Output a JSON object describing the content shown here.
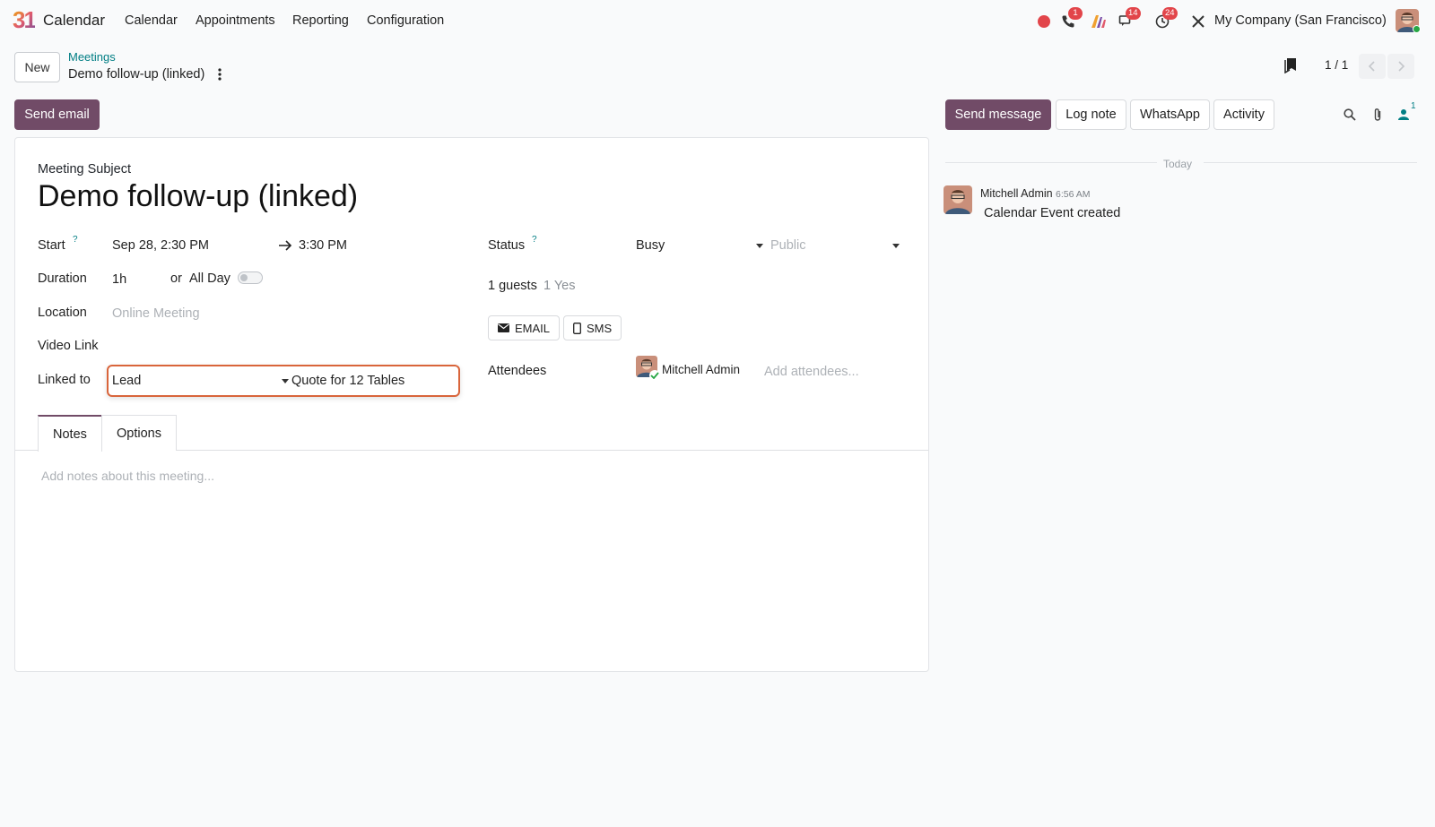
{
  "nav": {
    "app_name": "Calendar",
    "logo_text": "31",
    "menu": [
      "Calendar",
      "Appointments",
      "Reporting",
      "Configuration"
    ],
    "badges": {
      "calls": "1",
      "messages": "14",
      "activities": "24"
    },
    "company": "My Company (San Francisco)"
  },
  "control": {
    "new_label": "New",
    "breadcrumb_parent": "Meetings",
    "breadcrumb_current": "Demo follow-up (linked)",
    "pager": "1 / 1"
  },
  "actions": {
    "send_email": "Send email",
    "send_message": "Send message",
    "log_note": "Log note",
    "whatsapp": "WhatsApp",
    "activity": "Activity",
    "followers_count": "1"
  },
  "form": {
    "subject_label": "Meeting Subject",
    "subject": "Demo follow-up (linked)",
    "start_label": "Start",
    "help_mark": "?",
    "start_value": "Sep 28, 2:30 PM",
    "end_value": "3:30 PM",
    "duration_label": "Duration",
    "duration_value": "1h",
    "or_text": "or",
    "allday_label": "All Day",
    "location_label": "Location",
    "location_placeholder": "Online Meeting",
    "videolink_label": "Video Link",
    "linked_label": "Linked to",
    "linked_model": "Lead",
    "linked_record": "Quote for 12 Tables",
    "status_label": "Status",
    "status_value": "Busy",
    "privacy_placeholder": "Public",
    "guests_text": "1 guests",
    "guests_yes": "1 Yes",
    "email_btn": "EMAIL",
    "sms_btn": "SMS",
    "attendees_label": "Attendees",
    "attendee_name": "Mitchell Admin",
    "add_attendees_placeholder": "Add attendees...",
    "tabs": [
      "Notes",
      "Options"
    ],
    "notes_placeholder": "Add notes about this meeting..."
  },
  "chatter": {
    "separator": "Today",
    "author": "Mitchell Admin",
    "time": "6:56 AM",
    "body": "Calendar Event created"
  },
  "colors": {
    "brand": "#714b67",
    "accent": "#017e84",
    "focus": "#d9653b",
    "badge": "#e2454a"
  }
}
